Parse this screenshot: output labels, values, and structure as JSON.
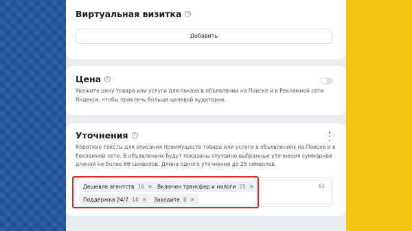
{
  "cards": {
    "vcard": {
      "title": "Виртуальная визитка",
      "add_button": "Добавить"
    },
    "price": {
      "title": "Цена",
      "description": "Укажите цену товара или услуги для показа в объявлении на Поиске и в Рекламной сети Яндекса, чтобы привлечь больше целевой аудитории.",
      "toggle_on": false
    },
    "callouts": {
      "title": "Уточнения",
      "description": "Короткие тексты для описания преимуществ товара или услуги в объявлениях на Поиске и в Рекламной сети. В объявлениях будут показаны случайно выбранные уточнения суммарной длиной не более 66 символов. Длина одного уточнения до 25 символов.",
      "counter": "63",
      "chips": [
        {
          "label": "Дешевле агентств",
          "count": "16"
        },
        {
          "label": "Включен трансфер и налоги",
          "count": "25"
        },
        {
          "label": "Поддержка 24/7",
          "count": "14"
        },
        {
          "label": "Заходите",
          "count": "8"
        }
      ]
    }
  },
  "icons": {
    "help": "question-circle-icon",
    "close": "close-icon",
    "menu": "kebab-menu-icon"
  },
  "colors": {
    "highlight": "#e32525",
    "background_blue": "#1f4f96",
    "background_yellow": "#f4c213"
  }
}
